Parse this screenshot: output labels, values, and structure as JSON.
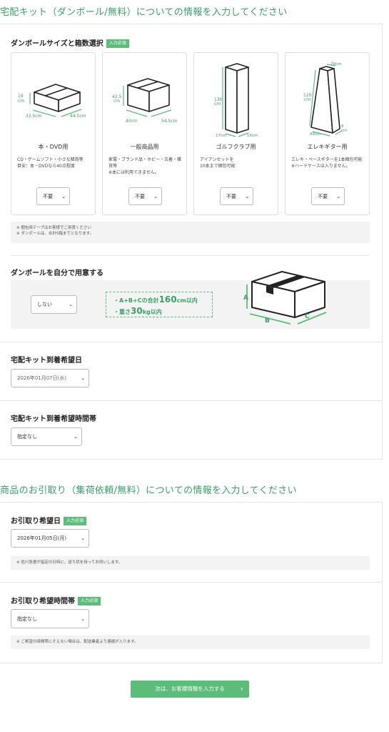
{
  "kit_section": {
    "title": "宅配キット（ダンボール/無料）についての情報を入力してください",
    "size_label": "ダンボールサイズと箱数選択",
    "required_badge": "入力必須",
    "cards": [
      {
        "title": "本・DVD用",
        "desc": "CD・ゲームソフト・小さな雑貨等\n目安：本・DVDなら40点程度",
        "select": "不要",
        "dims": [
          "19cm",
          "32.5cm",
          "44.5cm"
        ]
      },
      {
        "title": "一般商品用",
        "desc": "家電・ブランド品・ホビー・古着・雑貨等\n※本には利用できません。",
        "select": "不要",
        "dims": [
          "42.5cm",
          "40cm",
          "54.5cm"
        ]
      },
      {
        "title": "ゴルフクラブ用",
        "desc": "アイアンセットを\n10本まで梱包可能",
        "select": "不要",
        "dims": [
          "130cm",
          "17cm",
          "16cm"
        ]
      },
      {
        "title": "エレキギター用",
        "desc": "エレキ・ベースギターを1本梱包可能\n※ハードケースは入りません。",
        "select": "不要",
        "dims": [
          "20cm",
          "120cm",
          "40cm",
          "8cm"
        ]
      }
    ],
    "notes": [
      "※ 梱包用テープはお客様でご用意ください",
      "※ ダンボールは、合計5箱までとなります。"
    ],
    "own_box_label": "ダンボールを自分で用意する",
    "own_box_select": "しない",
    "own_box_rule1_pre": "・A+B+Cの合計",
    "own_box_rule1_num": "160",
    "own_box_rule1_post": "cm以内",
    "own_box_rule2_pre": "・重さ",
    "own_box_rule2_num": "30",
    "own_box_rule2_post": "kg以内",
    "box_letters": [
      "A",
      "B",
      "C"
    ],
    "arrival_date_label": "宅配キット到着希望日",
    "arrival_date_value": "2026年01月07日(水)",
    "arrival_time_label": "宅配キット到着希望時間帯",
    "arrival_time_value": "指定なし"
  },
  "pickup_section": {
    "title": "商品のお引取り（集荷依頼/無料）についての情報を入力してください",
    "date_label": "お引取り希望日",
    "date_value": "2026年01月05日(月)",
    "date_note": "※ 佐川急便が指定の日時に、送り状を持ってお伺いします。",
    "time_label": "お引取り希望時間帯",
    "time_value": "指定なし",
    "time_note": "※ ご希望の時間帯にそえない場合は、配送業者より連絡が入ります。",
    "required_badge": "入力必須"
  },
  "next_button": {
    "label": "次は、お客様情報を入力する",
    "arrow": "›"
  },
  "colors": {
    "accent": "#5cbd7b",
    "title": "#3a9f68"
  }
}
